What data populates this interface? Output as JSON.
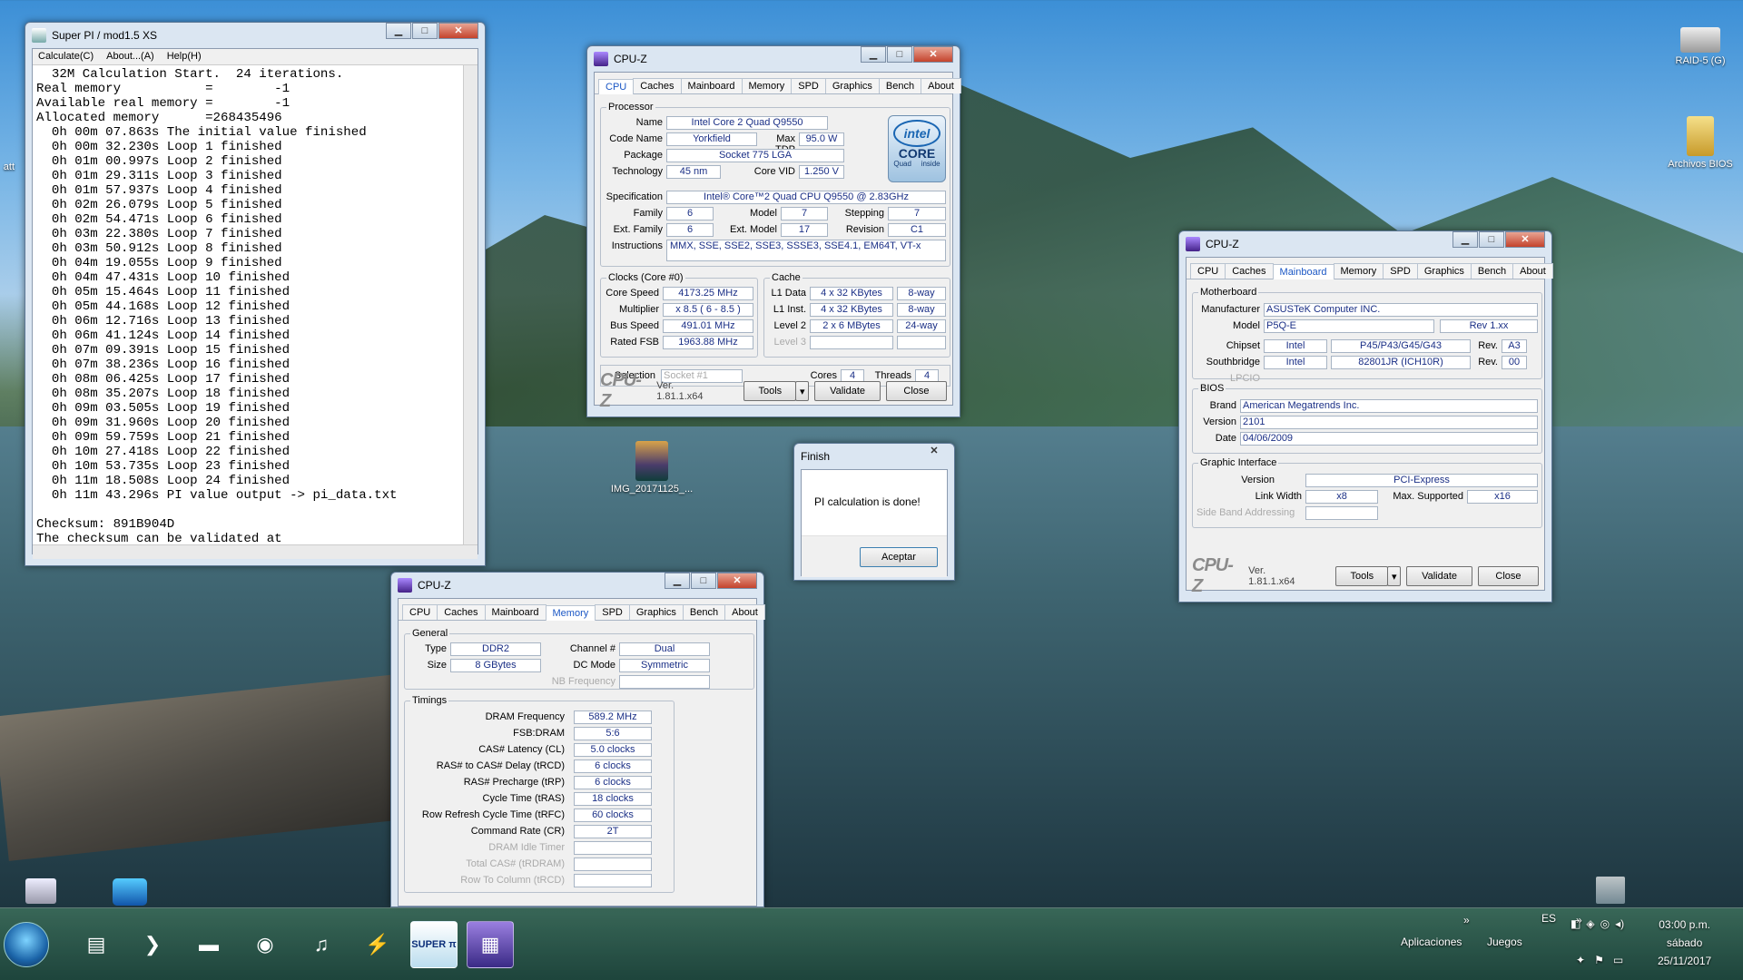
{
  "desktop": {
    "icons": [
      {
        "label": "RAID-5 (G)",
        "name": "raid-drive-icon"
      },
      {
        "label": "Archivos BIOS",
        "name": "bios-folder-icon"
      },
      {
        "label": "IMG_20171125_...",
        "name": "image-file-icon"
      },
      {
        "label": "att",
        "name": "partial-icon"
      }
    ]
  },
  "superpi": {
    "title": "Super PI / mod1.5 XS",
    "menu": [
      "Calculate(C)",
      "About...(A)",
      "Help(H)"
    ],
    "lines": [
      "  32M Calculation Start.  24 iterations.",
      "Real memory           =        -1",
      "Available real memory =        -1",
      "Allocated memory      =268435496",
      "  0h 00m 07.863s The initial value finished",
      "  0h 00m 32.230s Loop 1 finished",
      "  0h 01m 00.997s Loop 2 finished",
      "  0h 01m 29.311s Loop 3 finished",
      "  0h 01m 57.937s Loop 4 finished",
      "  0h 02m 26.079s Loop 5 finished",
      "  0h 02m 54.471s Loop 6 finished",
      "  0h 03m 22.380s Loop 7 finished",
      "  0h 03m 50.912s Loop 8 finished",
      "  0h 04m 19.055s Loop 9 finished",
      "  0h 04m 47.431s Loop 10 finished",
      "  0h 05m 15.464s Loop 11 finished",
      "  0h 05m 44.168s Loop 12 finished",
      "  0h 06m 12.716s Loop 13 finished",
      "  0h 06m 41.124s Loop 14 finished",
      "  0h 07m 09.391s Loop 15 finished",
      "  0h 07m 38.236s Loop 16 finished",
      "  0h 08m 06.425s Loop 17 finished",
      "  0h 08m 35.207s Loop 18 finished",
      "  0h 09m 03.505s Loop 19 finished",
      "  0h 09m 31.960s Loop 20 finished",
      "  0h 09m 59.759s Loop 21 finished",
      "  0h 10m 27.418s Loop 22 finished",
      "  0h 10m 53.735s Loop 23 finished",
      "  0h 11m 18.508s Loop 24 finished",
      "  0h 11m 43.296s PI value output -> pi_data.txt",
      "",
      "Checksum: 891B904D",
      "The checksum can be validated at"
    ]
  },
  "cpuz_common": {
    "title": "CPU-Z",
    "tabs": [
      "CPU",
      "Caches",
      "Mainboard",
      "Memory",
      "SPD",
      "Graphics",
      "Bench",
      "About"
    ],
    "brand": "CPU-Z",
    "version": "Ver. 1.81.1.x64",
    "tools": "Tools",
    "validate": "Validate",
    "close": "Close"
  },
  "cpu": {
    "processor_label": "Processor",
    "name_label": "Name",
    "name": "Intel Core 2 Quad Q9550",
    "code_label": "Code Name",
    "code": "Yorkfield",
    "tdp_label": "Max TDP",
    "tdp": "95.0 W",
    "package_label": "Package",
    "package": "Socket 775 LGA",
    "tech_label": "Technology",
    "tech": "45 nm",
    "vid_label": "Core VID",
    "vid": "1.250 V",
    "spec_label": "Specification",
    "spec": "Intel® Core™2 Quad  CPU   Q9550  @ 2.83GHz",
    "family_label": "Family",
    "family": "6",
    "model_label": "Model",
    "model": "7",
    "stepping_label": "Stepping",
    "stepping": "7",
    "extfam_label": "Ext. Family",
    "extfam": "6",
    "extmodel_label": "Ext. Model",
    "extmodel": "17",
    "revision_label": "Revision",
    "revision": "C1",
    "instr_label": "Instructions",
    "instr": "MMX, SSE, SSE2, SSE3, SSSE3, SSE4.1, EM64T, VT-x",
    "clocks_label": "Clocks (Core #0)",
    "corespeed_label": "Core Speed",
    "corespeed": "4173.25 MHz",
    "mult_label": "Multiplier",
    "mult": "x 8.5 ( 6 - 8.5 )",
    "bus_label": "Bus Speed",
    "bus": "491.01 MHz",
    "fsb_label": "Rated FSB",
    "fsb": "1963.88 MHz",
    "cache_label": "Cache",
    "l1d_label": "L1 Data",
    "l1d": "4 x 32 KBytes",
    "l1d_way": "8-way",
    "l1i_label": "L1 Inst.",
    "l1i": "4 x 32 KBytes",
    "l1i_way": "8-way",
    "l2_label": "Level 2",
    "l2": "2 x 6 MBytes",
    "l2_way": "24-way",
    "l3_label": "Level 3",
    "sel_label": "Selection",
    "sel": "Socket #1",
    "cores_label": "Cores",
    "cores": "4",
    "threads_label": "Threads",
    "threads": "4",
    "logo_top": "intel",
    "logo_mid": "CORE",
    "logo_sub": "Quad",
    "logo_inside": "inside"
  },
  "mainboard": {
    "mb_label": "Motherboard",
    "mfr_label": "Manufacturer",
    "mfr": "ASUSTeK Computer INC.",
    "model_label": "Model",
    "model": "P5Q-E",
    "model_rev": "Rev 1.xx",
    "chipset_label": "Chipset",
    "chipset_vendor": "Intel",
    "chipset": "P45/P43/G45/G43",
    "chipset_rev_label": "Rev.",
    "chipset_rev": "A3",
    "sb_label": "Southbridge",
    "sb_vendor": "Intel",
    "sb": "82801JR (ICH10R)",
    "sb_rev_label": "Rev.",
    "sb_rev": "00",
    "lpcio_label": "LPCIO",
    "bios_label": "BIOS",
    "brand_label": "Brand",
    "brand": "American Megatrends Inc.",
    "version_label": "Version",
    "version": "2101",
    "date_label": "Date",
    "date": "04/06/2009",
    "gi_label": "Graphic Interface",
    "giver_label": "Version",
    "giver": "PCI-Express",
    "lw_label": "Link Width",
    "lw": "x8",
    "max_label": "Max. Supported",
    "max": "x16",
    "sba_label": "Side Band Addressing"
  },
  "memory": {
    "general_label": "General",
    "type_label": "Type",
    "type": "DDR2",
    "size_label": "Size",
    "size": "8 GBytes",
    "channel_label": "Channel #",
    "channel": "Dual",
    "dc_label": "DC Mode",
    "dc": "Symmetric",
    "nb_label": "NB Frequency",
    "timings_label": "Timings",
    "rows": [
      {
        "label": "DRAM Frequency",
        "value": "589.2 MHz",
        "dis": false
      },
      {
        "label": "FSB:DRAM",
        "value": "5:6",
        "dis": false
      },
      {
        "label": "CAS# Latency (CL)",
        "value": "5.0 clocks",
        "dis": false
      },
      {
        "label": "RAS# to CAS# Delay (tRCD)",
        "value": "6 clocks",
        "dis": false
      },
      {
        "label": "RAS# Precharge (tRP)",
        "value": "6 clocks",
        "dis": false
      },
      {
        "label": "Cycle Time (tRAS)",
        "value": "18 clocks",
        "dis": false
      },
      {
        "label": "Row Refresh Cycle Time (tRFC)",
        "value": "60 clocks",
        "dis": false
      },
      {
        "label": "Command Rate (CR)",
        "value": "2T",
        "dis": false
      },
      {
        "label": "DRAM Idle Timer",
        "value": "",
        "dis": true
      },
      {
        "label": "Total CAS# (tRDRAM)",
        "value": "",
        "dis": true
      },
      {
        "label": "Row To Column (tRCD)",
        "value": "",
        "dis": true
      }
    ]
  },
  "finish": {
    "title": "Finish",
    "message": "PI calculation is done!",
    "ok": "Aceptar"
  },
  "taskbar": {
    "items": [
      {
        "name": "file-manager-icon",
        "glyph": "▤"
      },
      {
        "name": "powershell-icon",
        "glyph": "❯"
      },
      {
        "name": "explorer-folder-icon",
        "glyph": "▬"
      },
      {
        "name": "chrome-icon",
        "glyph": "◉"
      },
      {
        "name": "itunes-icon",
        "glyph": "♫"
      },
      {
        "name": "tool-icon",
        "glyph": "⚡"
      },
      {
        "name": "superpi-task-icon",
        "glyph": "SUPER π"
      },
      {
        "name": "cpuz-task-icon",
        "glyph": "▦"
      }
    ],
    "lang": "ES",
    "apps_label": "Aplicaciones",
    "games_label": "Juegos",
    "chevron": "»",
    "time": "03:00 p.m.",
    "day": "sábado",
    "date": "25/11/2017"
  }
}
